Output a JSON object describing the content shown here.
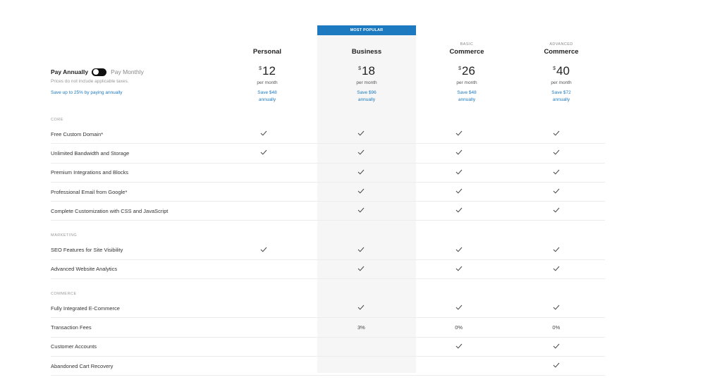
{
  "banner": {
    "most_popular": "MOST POPULAR"
  },
  "billing": {
    "pay_annually": "Pay Annually",
    "pay_monthly": "Pay Monthly",
    "tax_note": "Prices do not include applicable taxes.",
    "save_note": "Save up to 25% by paying annually"
  },
  "plans": [
    {
      "sub": "",
      "name": "Personal",
      "currency": "$",
      "price": "12",
      "per": "per month",
      "save1": "Save $48",
      "save2": "annually"
    },
    {
      "sub": "",
      "name": "Business",
      "currency": "$",
      "price": "18",
      "per": "per month",
      "save1": "Save $96",
      "save2": "annually"
    },
    {
      "sub": "BASIC",
      "name": "Commerce",
      "currency": "$",
      "price": "26",
      "per": "per month",
      "save1": "Save $48",
      "save2": "annually"
    },
    {
      "sub": "ADVANCED",
      "name": "Commerce",
      "currency": "$",
      "price": "40",
      "per": "per month",
      "save1": "Save $72",
      "save2": "annually"
    }
  ],
  "sections": [
    {
      "label": "CORE",
      "rows": [
        {
          "name": "Free Custom Domain*",
          "cells": [
            "check",
            "check",
            "check",
            "check"
          ]
        },
        {
          "name": "Unlimited Bandwidth and Storage",
          "cells": [
            "check",
            "check",
            "check",
            "check"
          ]
        },
        {
          "name": "Premium Integrations and Blocks",
          "cells": [
            "",
            "check",
            "check",
            "check"
          ]
        },
        {
          "name": "Professional Email from Google*",
          "cells": [
            "",
            "check",
            "check",
            "check"
          ]
        },
        {
          "name": "Complete Customization with CSS and JavaScript",
          "cells": [
            "",
            "check",
            "check",
            "check"
          ]
        }
      ]
    },
    {
      "label": "MARKETING",
      "rows": [
        {
          "name": "SEO Features for Site Visibility",
          "cells": [
            "check",
            "check",
            "check",
            "check"
          ]
        },
        {
          "name": "Advanced Website Analytics",
          "cells": [
            "",
            "check",
            "check",
            "check"
          ]
        }
      ]
    },
    {
      "label": "COMMERCE",
      "rows": [
        {
          "name": "Fully Integrated E-Commerce",
          "cells": [
            "",
            "check",
            "check",
            "check"
          ]
        },
        {
          "name": "Transaction Fees",
          "cells": [
            "",
            "3%",
            "0%",
            "0%"
          ]
        },
        {
          "name": "Customer Accounts",
          "cells": [
            "",
            "",
            "check",
            "check"
          ]
        },
        {
          "name": "Abandoned Cart Recovery",
          "cells": [
            "",
            "",
            "",
            "check"
          ]
        }
      ]
    }
  ],
  "icons": {
    "check": "checkmark-icon"
  },
  "colors": {
    "accent": "#1d7ac1",
    "popular_column": "#f6f6f6",
    "toggle": "#111111"
  }
}
